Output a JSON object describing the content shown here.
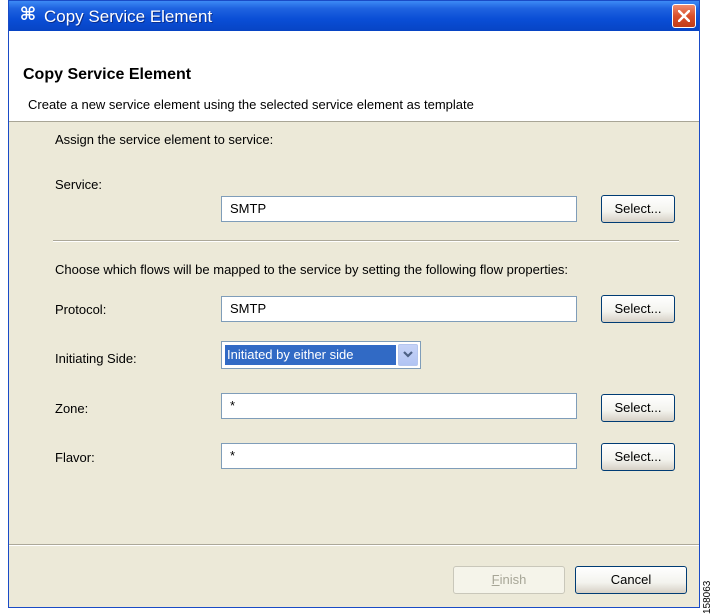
{
  "window": {
    "title": "Copy Service Element",
    "colors": {
      "titlebar": "#0a4ed6",
      "close": "#d9502c",
      "body": "#ece9d8"
    }
  },
  "banner": {
    "title": "Copy Service Element",
    "description": "Create a new service element using the selected service element as template"
  },
  "form": {
    "assign_heading": "Assign the service element to service:",
    "service": {
      "label": "Service:",
      "value": "SMTP",
      "button": "Select..."
    },
    "flows_heading": "Choose which flows will be mapped to the service by setting the following flow properties:",
    "protocol": {
      "label": "Protocol:",
      "value": "SMTP",
      "button": "Select..."
    },
    "initiating_side": {
      "label": "Initiating Side:",
      "value": "Initiated by either side"
    },
    "zone": {
      "label": "Zone:",
      "value": "*",
      "button": "Select..."
    },
    "flavor": {
      "label": "Flavor:",
      "value": "*",
      "button": "Select..."
    }
  },
  "footer": {
    "finish": {
      "label": "Finish",
      "enabled": false
    },
    "cancel": {
      "label": "Cancel"
    }
  },
  "side_label": "158063"
}
